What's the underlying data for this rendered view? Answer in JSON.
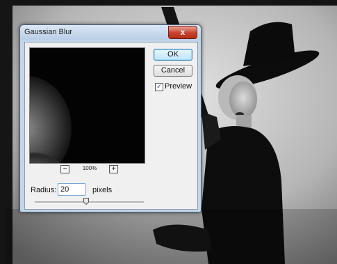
{
  "dialog": {
    "title": "Gaussian Blur",
    "close_symbol": "x",
    "ok_label": "OK",
    "cancel_label": "Cancel",
    "preview_label": "Preview",
    "preview_checked": true,
    "preview_check_mark": "✓",
    "zoom_out_symbol": "−",
    "zoom_in_symbol": "+",
    "zoom_level": "100%",
    "radius_label": "Radius:",
    "radius_value": "20",
    "radius_unit": "pixels",
    "slider_fraction": 0.47
  },
  "colors": {
    "dialog_frame": "#c4d6ea",
    "close_button": "#c8412b",
    "content_bg": "#f0f0f0"
  },
  "icons": [
    "close-icon",
    "zoom-out-icon",
    "zoom-in-icon",
    "checkmark-icon",
    "slider-thumb-icon"
  ]
}
